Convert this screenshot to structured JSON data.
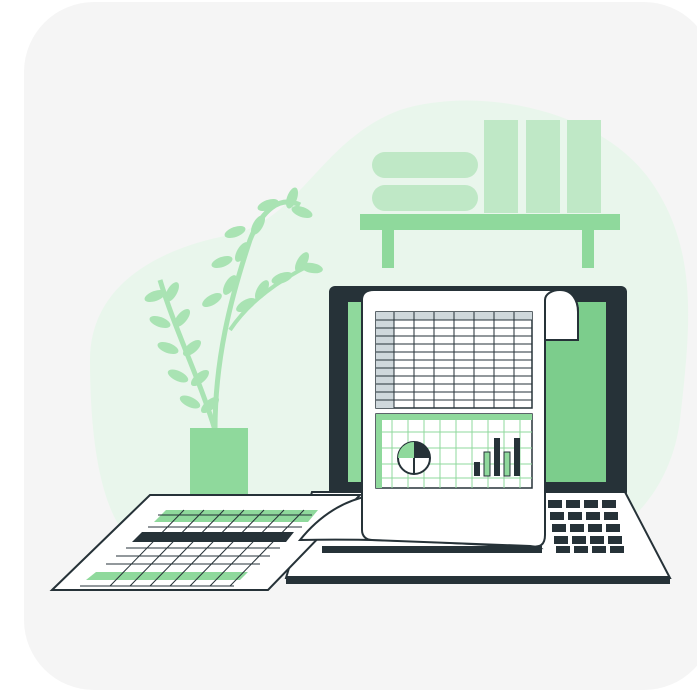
{
  "colors": {
    "background_card": "#f5f5f5",
    "blob": "#e9f6ec",
    "green": "#8fd99c",
    "green_light": "#bfe8c6",
    "green_mid": "#a9e3b3",
    "dark": "#263238",
    "paper": "#ffffff",
    "outline": "#263238"
  },
  "illustration": {
    "subject": "spreadsheet-on-laptop",
    "elements": [
      "books",
      "wall-shelf",
      "potted-plant",
      "laptop",
      "spreadsheet-paper",
      "loose-spreadsheet-sheet"
    ]
  }
}
